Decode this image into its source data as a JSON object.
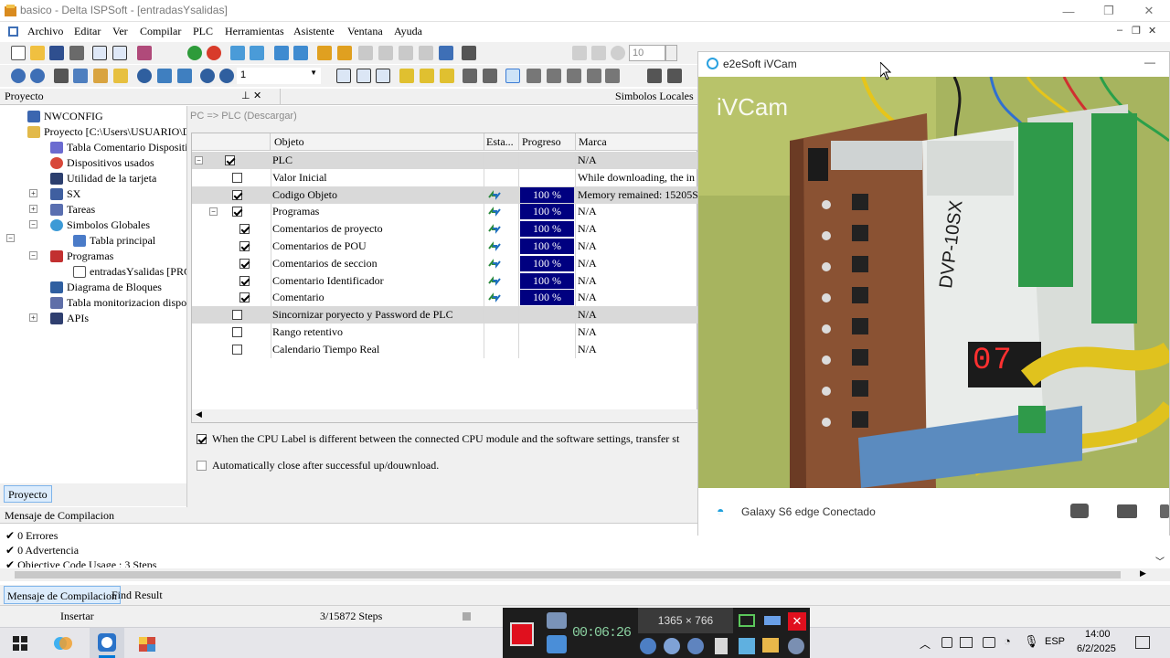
{
  "window": {
    "title": "basico - Delta ISPSoft - [entradasYsalidas]"
  },
  "menu": [
    "Archivo",
    "Editar",
    "Ver",
    "Compilar",
    "PLC",
    "Herramientas",
    "Asistente",
    "Ventana",
    "Ayuda"
  ],
  "toolbar": {
    "spin_value": "10",
    "zoom_value": "1"
  },
  "project_panel": {
    "title": "Proyecto",
    "tab_label": "Proyecto",
    "tree": [
      {
        "label": "NWCONFIG"
      },
      {
        "label": "Proyecto [C:\\Users\\USUARIO\\De"
      },
      {
        "label": "Tabla Comentario Dispositiv"
      },
      {
        "label": "Dispositivos usados"
      },
      {
        "label": "Utilidad de la tarjeta"
      },
      {
        "label": "SX"
      },
      {
        "label": "Tareas"
      },
      {
        "label": "Simbolos Globales"
      },
      {
        "label": "Tabla principal"
      },
      {
        "label": "Programas"
      },
      {
        "label": "entradasYsalidas [PRG"
      },
      {
        "label": "Diagrama de Bloques"
      },
      {
        "label": "Tabla monitorizacion disposi"
      },
      {
        "label": "APIs"
      }
    ]
  },
  "local_symbols_tab": "Simbolos Locales",
  "download_dialog": {
    "title": "PC => PLC (Descargar)",
    "columns": [
      "Objeto",
      "Esta...",
      "Progreso",
      "Marca"
    ],
    "rows": [
      {
        "objeto": "PLC",
        "progress": "",
        "marca": "N/A",
        "checked": true,
        "status": false
      },
      {
        "objeto": "Valor Inicial",
        "progress": "",
        "marca": "While downloading, the in",
        "checked": false,
        "status": false
      },
      {
        "objeto": "Codigo Objeto",
        "progress": "100 %",
        "marca": "Memory remained: 15205S",
        "checked": true,
        "status": true
      },
      {
        "objeto": "Programas",
        "progress": "100 %",
        "marca": "N/A",
        "checked": true,
        "status": true
      },
      {
        "objeto": "Comentarios de proyecto",
        "progress": "100 %",
        "marca": "N/A",
        "checked": true,
        "status": true
      },
      {
        "objeto": "Comentarios de POU",
        "progress": "100 %",
        "marca": "N/A",
        "checked": true,
        "status": true
      },
      {
        "objeto": "Comentarios de seccion",
        "progress": "100 %",
        "marca": "N/A",
        "checked": true,
        "status": true
      },
      {
        "objeto": "Comentario Identificador",
        "progress": "100 %",
        "marca": "N/A",
        "checked": true,
        "status": true
      },
      {
        "objeto": "Comentario",
        "progress": "100 %",
        "marca": "N/A",
        "checked": true,
        "status": true
      },
      {
        "objeto": "Sincornizar poryecto y Password de PLC",
        "progress": "",
        "marca": "N/A",
        "checked": false,
        "status": false
      },
      {
        "objeto": "Rango retentivo",
        "progress": "",
        "marca": "N/A",
        "checked": false,
        "status": false
      },
      {
        "objeto": "Calendario Tiempo Real",
        "progress": "",
        "marca": "N/A",
        "checked": false,
        "status": false
      }
    ],
    "option_cpu_label": "When the CPU Label is different between the connected CPU module and the software settings, transfer st",
    "option_cpu_label_checked": true,
    "option_auto_close": "Automatically close after successful up/douwnload.",
    "option_auto_close_checked": false
  },
  "ivcam": {
    "title": "e2eSoft iVCam",
    "watermark": "iVCam",
    "device_status": "Galaxy S6 edge Conectado",
    "device_model_text": "DVP-10SX",
    "display_digits": "07"
  },
  "compile_panel": {
    "title": "Mensaje de Compilacion",
    "messages": [
      "0 Errores",
      "0 Advertencia",
      "Objective Code Usage : 3 Steps"
    ],
    "tabs": [
      "Mensaje de Compilacion",
      "Find Result"
    ]
  },
  "statusbar": {
    "mode": "Insertar",
    "steps": "3/15872 Steps"
  },
  "recorder": {
    "resolution": "1365 × 766",
    "timer": "00:06:26"
  },
  "taskbar": {
    "language": "ESP",
    "time": "14:00",
    "date": "6/2/2025"
  },
  "colors": {
    "progress": "#000080",
    "selection": "#cce8ff",
    "accent": "#0078d7"
  }
}
